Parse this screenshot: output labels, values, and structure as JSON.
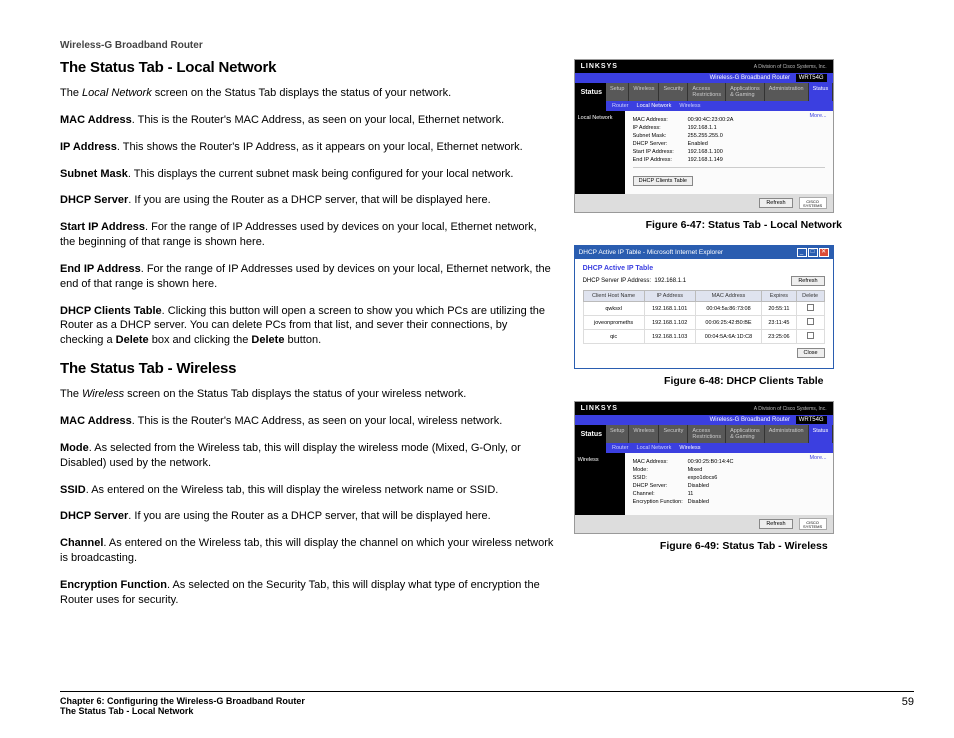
{
  "header": {
    "product": "Wireless-G Broadband Router"
  },
  "section1": {
    "title": "The Status Tab - Local Network",
    "intro_prefix": "The ",
    "intro_ital": "Local Network",
    "intro_rest": " screen on the Status Tab displays the status of your network.",
    "items": [
      {
        "term": "MAC Address",
        "text": ". This is the Router's MAC Address, as seen on your local, Ethernet network."
      },
      {
        "term": "IP Address",
        "text": ". This shows the Router's IP Address, as it appears on your local, Ethernet network."
      },
      {
        "term": "Subnet Mask",
        "text": ". This displays the current subnet mask being configured for your local network."
      },
      {
        "term": "DHCP Server",
        "text": ". If you are using the Router as a DHCP server, that will be displayed here."
      },
      {
        "term": "Start IP Address",
        "text": ". For the range of IP Addresses used by devices on your local, Ethernet network, the beginning of that range is shown here."
      },
      {
        "term": "End IP Address",
        "text": ". For the range of IP Addresses used by devices on your local, Ethernet network, the end of that range is shown here."
      }
    ],
    "dhcp_term": "DHCP Clients Table",
    "dhcp_text1": ". Clicking this button will open a screen to show you which PCs are utilizing the Router as a DHCP server. You can delete PCs from that list, and sever their connections, by checking a ",
    "dhcp_bold1": "Delete",
    "dhcp_text2": " box and clicking the ",
    "dhcp_bold2": "Delete",
    "dhcp_text3": " button."
  },
  "section2": {
    "title": "The Status Tab - Wireless",
    "intro_prefix": "The ",
    "intro_ital": "Wireless",
    "intro_rest": " screen on the Status Tab displays the status of your wireless network.",
    "items": [
      {
        "term": "MAC Address",
        "text": ". This is the Router's MAC Address, as seen on your local, wireless network."
      },
      {
        "term": "Mode",
        "text": ". As selected from the Wireless tab, this will display the wireless mode (Mixed, G-Only, or Disabled) used by the network."
      },
      {
        "term": "SSID",
        "text": ". As entered on the Wireless tab, this will display the wireless network name or SSID."
      },
      {
        "term": "DHCP Server",
        "text": ". If you are using the Router as a DHCP server, that will be displayed here."
      },
      {
        "term": "Channel",
        "text": ". As entered on the Wireless tab, this will display the channel on which your wireless network is broadcasting."
      },
      {
        "term": "Encryption Function",
        "text": ". As selected on the Security Tab, this will display what type of encryption the Router uses for security."
      }
    ]
  },
  "fig47": {
    "caption": "Figure 6-47: Status Tab - Local Network",
    "brand": "LINKSYS",
    "tagline": "A Division of Cisco Systems, Inc.",
    "barTitle": "Wireless-G Broadband Router",
    "model": "WRT54G",
    "statusLabel": "Status",
    "tabs": [
      "Setup",
      "Wireless",
      "Security",
      "Access Restrictions",
      "Applications & Gaming",
      "Administration",
      "Status"
    ],
    "subtabs": [
      "Router",
      "Local Network",
      "Wireless"
    ],
    "side": "Local Network",
    "more": "More...",
    "rows": [
      {
        "k": "MAC Address:",
        "v": "00:90:4C:23:00:2A"
      },
      {
        "k": "IP Address:",
        "v": "192.168.1.1"
      },
      {
        "k": "Subnet Mask:",
        "v": "255.255.255.0"
      },
      {
        "k": "DHCP Server:",
        "v": "Enabled"
      },
      {
        "k": "Start IP Address:",
        "v": "192.168.1.100"
      },
      {
        "k": "End IP Address:",
        "v": "192.168.1.149"
      }
    ],
    "btn": "DHCP Clients Table",
    "refresh": "Refresh",
    "cisco": "CISCO SYSTEMS"
  },
  "fig48": {
    "caption": "Figure 6-48: DHCP Clients Table",
    "winTitle": "DHCP Active IP Table - Microsoft Internet Explorer",
    "heading": "DHCP Active IP Table",
    "serverLabel": "DHCP Server IP Address:",
    "serverIp": "192.168.1.1",
    "refresh": "Refresh",
    "cols": [
      "Client Host Name",
      "IP Address",
      "MAC Address",
      "Expires"
    ],
    "delete": "Delete",
    "close": "Close",
    "rows": [
      {
        "c0": "qwksxl",
        "c1": "192.168.1.101",
        "c2": "00:04:5a:86:73:08",
        "c3": "20:55:11"
      },
      {
        "c0": "joveonpromeths",
        "c1": "192.168.1.102",
        "c2": "00:06:25:42:B0:BE",
        "c3": "23:11:45"
      },
      {
        "c0": "qic",
        "c1": "192.168.1.103",
        "c2": "00:04:5A:6A:1D:C8",
        "c3": "23:25:06"
      }
    ]
  },
  "fig49": {
    "caption": "Figure 6-49: Status Tab - Wireless",
    "side": "Wireless",
    "rows": [
      {
        "k": "MAC Address:",
        "v": "00:90:25:B0:14:4C"
      },
      {
        "k": "Mode:",
        "v": "Mixed"
      },
      {
        "k": "SSID:",
        "v": "expo1docs6"
      },
      {
        "k": "DHCP Server:",
        "v": "Disabled"
      },
      {
        "k": "Channel:",
        "v": "11"
      },
      {
        "k": "Encryption Function:",
        "v": "Disabled"
      }
    ]
  },
  "footer": {
    "line1": "Chapter 6: Configuring the Wireless-G Broadband Router",
    "line2": "The Status Tab - Local Network",
    "page": "59"
  }
}
